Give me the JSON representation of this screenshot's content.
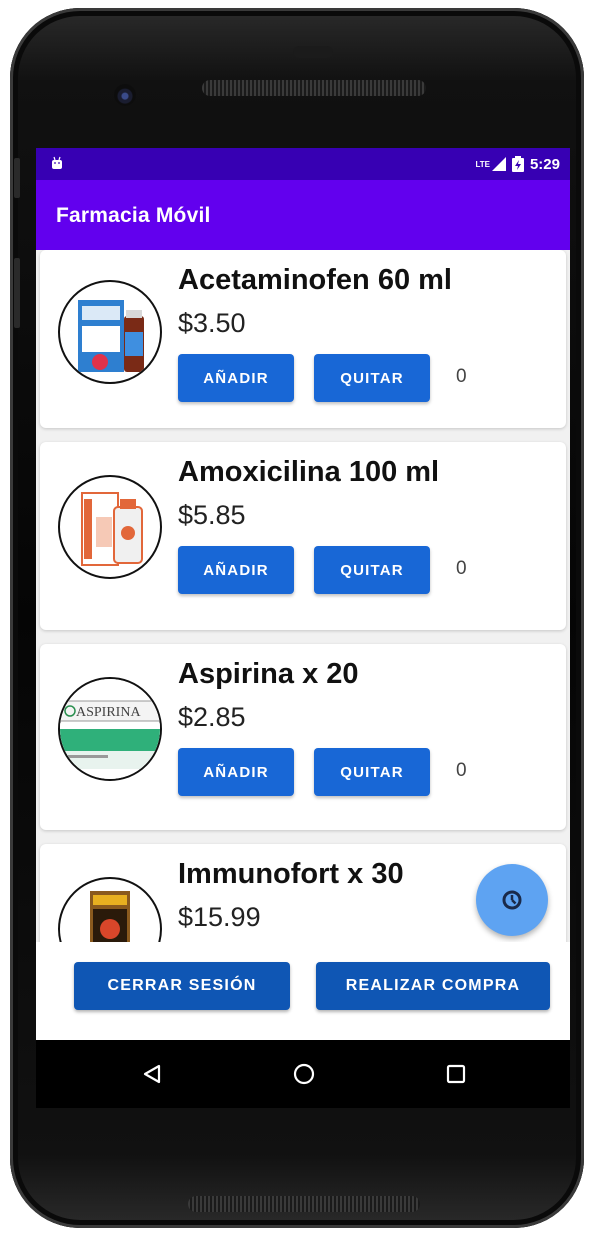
{
  "status_bar": {
    "network": "LTE",
    "time": "5:29"
  },
  "app_bar": {
    "title": "Farmacia Móvil"
  },
  "products": [
    {
      "name": "Acetaminofen 60 ml",
      "price": "$3.50",
      "add_label": "AÑADIR",
      "remove_label": "QUITAR",
      "quantity": "0"
    },
    {
      "name": "Amoxicilina 100 ml",
      "price": "$5.85",
      "add_label": "AÑADIR",
      "remove_label": "QUITAR",
      "quantity": "0"
    },
    {
      "name": "Aspirina x 20",
      "price": "$2.85",
      "add_label": "AÑADIR",
      "remove_label": "QUITAR",
      "quantity": "0"
    },
    {
      "name": "Immunofort x 30",
      "price": "$15.99"
    }
  ],
  "product_images": {
    "aspirina_label": "ASPIRINA"
  },
  "fab": {
    "icon": "history-clock-icon"
  },
  "bottom_bar": {
    "logout_label": "CERRAR SESIÓN",
    "purchase_label": "REALIZAR COMPRA"
  },
  "colors": {
    "status_bar": "#3700b3",
    "app_bar": "#6200ee",
    "button": "#1867d6",
    "bottom_button": "#0f56b4",
    "fab": "#5ea3f2"
  }
}
